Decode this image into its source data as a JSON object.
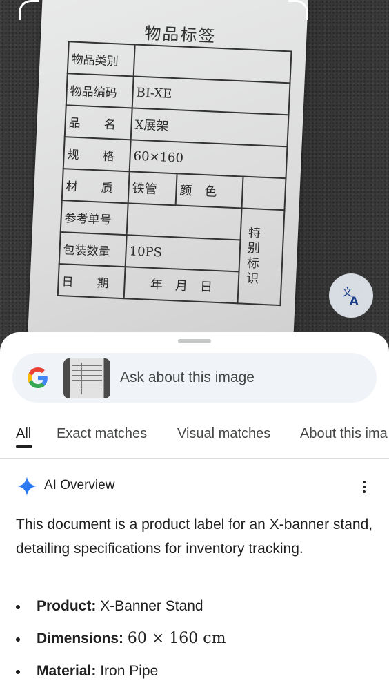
{
  "photo": {
    "label_title": "物品标签",
    "rows": [
      {
        "key": "物品类别",
        "value": ""
      },
      {
        "key": "物品编码",
        "value": "BI-XE"
      },
      {
        "key": "品　　名",
        "value": "X展架"
      },
      {
        "key": "规　　格",
        "value": "60×160"
      },
      {
        "key": "材　　质",
        "value": "铁管",
        "key2": "颜　色",
        "value2": ""
      },
      {
        "key": "参考单号",
        "value": ""
      },
      {
        "key": "包装数量",
        "value": "10PS"
      },
      {
        "key": "日　　期",
        "value": "年　月　日"
      }
    ],
    "side_mark": "特别标识"
  },
  "search": {
    "placeholder": "Ask about this image"
  },
  "tabs": [
    {
      "label": "All",
      "active": true
    },
    {
      "label": "Exact matches",
      "active": false
    },
    {
      "label": "Visual matches",
      "active": false
    },
    {
      "label": "About this ima",
      "active": false
    }
  ],
  "ai_overview": {
    "title": "AI Overview",
    "summary": "This document is a product label for an X-banner stand, detailing specifications for inventory tracking.",
    "bullets": [
      {
        "label": "Product:",
        "value": "X-Banner Stand"
      },
      {
        "label": "Dimensions:",
        "value": "60 × 160 cm"
      },
      {
        "label": "Material:",
        "value": "Iron Pipe"
      }
    ]
  },
  "colors": {
    "accent_blue": "#4285F4",
    "text_primary": "#1f1f1f",
    "search_bg": "#f0f3f8"
  },
  "icons": [
    "google-logo-icon",
    "translate-icon",
    "sparkle-icon",
    "more-vert-icon"
  ]
}
